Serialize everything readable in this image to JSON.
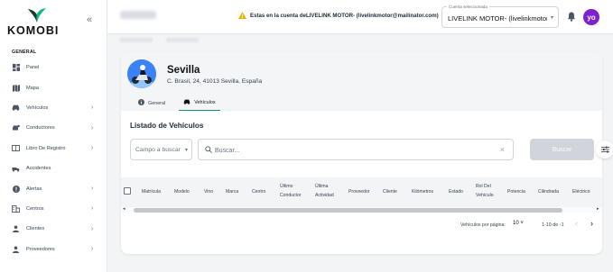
{
  "app": {
    "logo_text": "KOMOBI"
  },
  "sidebar": {
    "section_label": "GENERAL",
    "items": [
      {
        "label": "Panel",
        "icon": "dashboard-icon",
        "has_submenu": false
      },
      {
        "label": "Mapa",
        "icon": "map-icon",
        "has_submenu": false
      },
      {
        "label": "Vehículos",
        "icon": "car-icon",
        "has_submenu": true
      },
      {
        "label": "Conductores",
        "icon": "driver-icon",
        "has_submenu": true
      },
      {
        "label": "Libro De Registro",
        "icon": "logbook-icon",
        "has_submenu": true
      },
      {
        "label": "Accidentes",
        "icon": "accident-icon",
        "has_submenu": false
      },
      {
        "label": "Alertas",
        "icon": "alert-icon",
        "has_submenu": true
      },
      {
        "label": "Centros",
        "icon": "building-icon",
        "has_submenu": true
      },
      {
        "label": "Clientes",
        "icon": "clients-icon",
        "has_submenu": true
      },
      {
        "label": "Proveedores",
        "icon": "providers-icon",
        "has_submenu": true
      }
    ]
  },
  "header": {
    "warning_text": "Estas en la cuenta deLIVELINK MOTOR- (livelinkmotor@mailinator.com)",
    "account_select": {
      "label": "Cuenta seleccionada",
      "value": "LIVELINK MOTOR- (livelinkmotor@mailinator.com)"
    },
    "avatar_initials": "yo"
  },
  "site": {
    "name": "Sevilla",
    "address": "C. Brasil, 24, 41013 Sevilla, España"
  },
  "tabs": [
    {
      "label": "General",
      "icon": "info-icon",
      "active": false
    },
    {
      "label": "Vehículos",
      "icon": "car-icon",
      "active": true
    }
  ],
  "list": {
    "title": "Listado de Vehículos",
    "field_select_placeholder": "Campo a buscar",
    "search_placeholder": "Buscar...",
    "search_button": "Buscar"
  },
  "table": {
    "columns": [
      "Matrícula",
      "Modelo",
      "Vino",
      "Marca",
      "Centro",
      "Último Conductor",
      "Última Actividad",
      "Proveedor",
      "Cliente",
      "Kilómetros",
      "Estado",
      "Rol Del Vehículo",
      "Potencia",
      "Cilindrada",
      "Eléctrico"
    ]
  },
  "pagination": {
    "per_page_label": "Vehículos por página:",
    "per_page_value": "10",
    "range": "1-10 de -1"
  },
  "colors": {
    "accent": "#059669",
    "avatar_bg": "#7e22ce",
    "warning": "#eab308"
  }
}
